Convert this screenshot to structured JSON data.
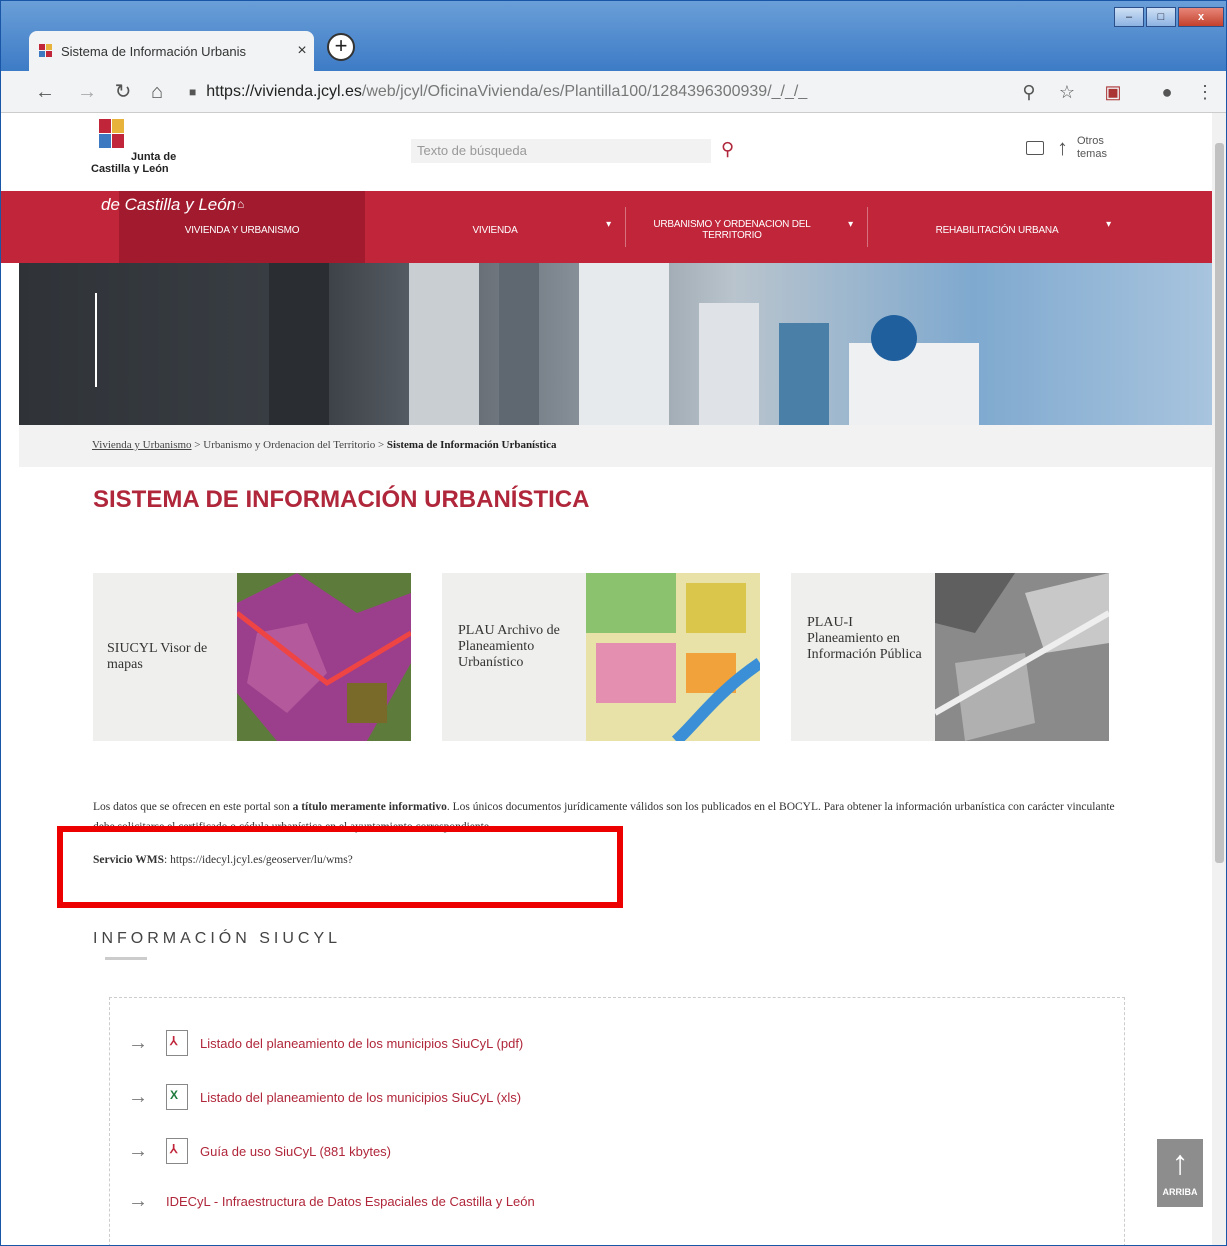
{
  "browser": {
    "tab_title": "Sistema de Información Urbanis",
    "tab_close": "×",
    "new_tab": "+",
    "url_host": "https://vivienda.jcyl.es",
    "url_path": "/web/jcyl/OficinaVivienda/es/Plantilla100/1284396300939/_/_/_",
    "window_controls": {
      "minimize": "–",
      "maximize": "□",
      "close": "x"
    }
  },
  "header": {
    "logo_line1": "Junta de",
    "logo_line2": "Castilla y León",
    "search_placeholder": "Texto de búsqueda",
    "others_label": "Otros temas"
  },
  "nav": {
    "items": [
      {
        "label": "VIVIENDA Y URBANISMO",
        "icon": "home-icon"
      },
      {
        "label": "VIVIENDA",
        "icon": "chevron-down-icon"
      },
      {
        "label": "URBANISMO Y ORDENACION DEL TERRITORIO",
        "icon": "chevron-down-icon"
      },
      {
        "label": "REHABILITACIÓN URBANA",
        "icon": "chevron-down-icon"
      }
    ]
  },
  "hero": {
    "title": "VIVIENDA Y URBANISMO",
    "subtitle": "de Castilla y León"
  },
  "breadcrumb": {
    "item1": "Vivienda y Urbanismo",
    "sep1": " > ",
    "item2": "Urbanismo y Ordenacion del Territorio",
    "sep2": " > ",
    "item3": "Sistema de Información Urbanística"
  },
  "page_title": "SISTEMA DE INFORMACIÓN URBANÍSTICA",
  "cards": [
    {
      "label": "SIUCYL Visor de mapas"
    },
    {
      "label": "PLAU Archivo de Planeamiento Urbanístico"
    },
    {
      "label": "PLAU-I Planeamiento en Información Pública"
    }
  ],
  "disclaimer": {
    "pre": "Los datos que se ofrecen en este portal son ",
    "bold": "a título meramente informativo",
    "post": ". Los únicos documentos jurídicamente válidos son los publicados en el BOCYL. Para obtener la información urbanística con carácter vinculante debe solicitarse el certificado o cédula urbanística en el ayuntamiento correspondiente."
  },
  "wms": {
    "label": "Servicio WMS",
    "url": ": https://idecyl.jcyl.es/geoserver/lu/wms?"
  },
  "section_title": "INFORMACIÓN SIUCYL",
  "links": [
    {
      "label": "Listado del planeamiento de los municipios SiuCyL (pdf)",
      "icon": "pdf-icon"
    },
    {
      "label": "Listado del planeamiento de los municipios SiuCyL (xls)",
      "icon": "xls-icon"
    },
    {
      "label": "Guía de uso SiuCyL (881 kbytes)",
      "icon": "pdf-icon"
    },
    {
      "label": "IDECyL - Infraestructura de Datos Espaciales de Castilla y León",
      "icon": "arrow-right-icon"
    }
  ],
  "back_to_top": "ARRIBA",
  "colors": {
    "brand_red": "#c0253a",
    "title_red": "#b0263a",
    "highlight": "#ec0000"
  }
}
